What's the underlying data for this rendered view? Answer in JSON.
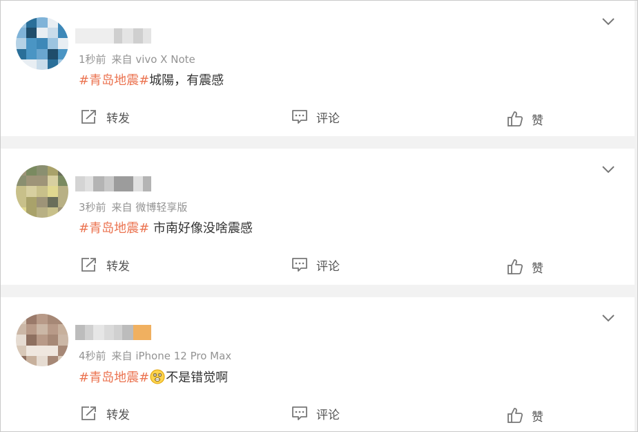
{
  "colors": {
    "hashtag": "#eb7350",
    "meta": "#939393",
    "text": "#333333",
    "action": "#555555",
    "divider": "#f2f2f2"
  },
  "posts": [
    {
      "username": "■■■■■■彡",
      "time": "1秒前",
      "source": "来自 vivo X Note",
      "hashtag": "#青岛地震#",
      "emoji": null,
      "text": "城陽，有震感",
      "actions": {
        "repost": "转发",
        "comment": "评论",
        "like": "赞"
      },
      "icons": {
        "menu": "chevron-down-icon",
        "repost": "repost-icon",
        "comment": "comment-icon",
        "like": "thumbs-up-icon"
      }
    },
    {
      "username": "■■■■■■■",
      "time": "3秒前",
      "source": "来自 微博轻享版",
      "hashtag": "#青岛地震#",
      "emoji": null,
      "text": " 市南好像没啥震感",
      "actions": {
        "repost": "转发",
        "comment": "评论",
        "like": "赞"
      },
      "icons": {
        "menu": "chevron-down-icon",
        "repost": "repost-icon",
        "comment": "comment-icon",
        "like": "thumbs-up-icon"
      }
    },
    {
      "username": "■■■■■■■",
      "time": "4秒前",
      "source": "来自 iPhone 12 Pro Max",
      "hashtag": "#青岛地震#",
      "emoji": "shocked-face-emoji",
      "text": "不是错觉啊",
      "actions": {
        "repost": "转发",
        "comment": "评论",
        "like": "赞"
      },
      "icons": {
        "menu": "chevron-down-icon",
        "repost": "repost-icon",
        "comment": "comment-icon",
        "like": "thumbs-up-icon"
      }
    }
  ]
}
